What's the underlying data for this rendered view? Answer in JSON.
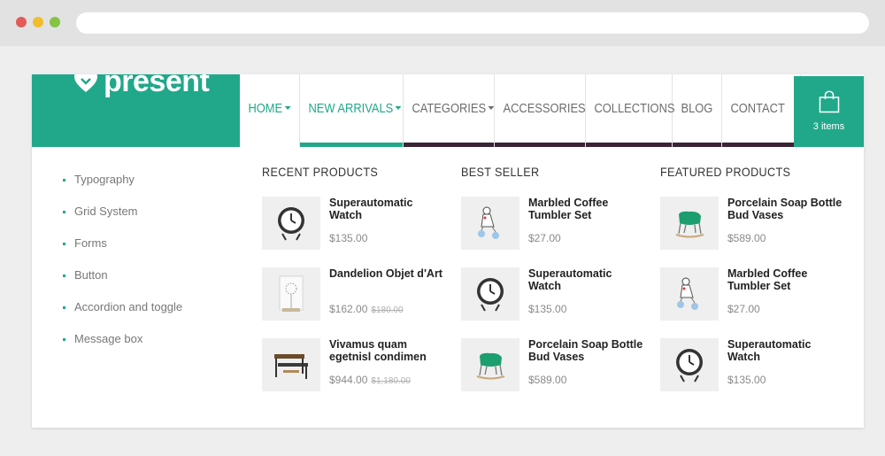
{
  "brand": {
    "name": "present",
    "color": "#21a88a",
    "accent_dark": "#3a2435"
  },
  "nav": [
    {
      "label": "HOME",
      "active": true,
      "has_caret": true
    },
    {
      "label": "NEW ARRIVALS",
      "active": true,
      "has_caret": true
    },
    {
      "label": "CATEGORIES",
      "active": false,
      "has_caret": true
    },
    {
      "label": "ACCESSORIES",
      "active": false,
      "has_caret": false
    },
    {
      "label": "COLLECTIONS",
      "active": false,
      "has_caret": false
    },
    {
      "label": "BLOG",
      "active": false,
      "has_caret": false
    },
    {
      "label": "CONTACT",
      "active": false,
      "has_caret": false
    }
  ],
  "cart": {
    "label": "3 items",
    "icon": "shopping-bag-icon"
  },
  "sidebar": {
    "items": [
      {
        "label": "Typography"
      },
      {
        "label": "Grid System"
      },
      {
        "label": "Forms"
      },
      {
        "label": "Button"
      },
      {
        "label": "Accordion and toggle"
      },
      {
        "label": "Message box"
      }
    ]
  },
  "columns": [
    {
      "title": "RECENT PRODUCTS",
      "products": [
        {
          "name": "Superautomatic Watch",
          "price": "$135.00",
          "old_price": "",
          "image": "clock"
        },
        {
          "name": "Dandelion Objet d'Art",
          "price": "$162.00",
          "old_price": "$180.00",
          "image": "dandelion"
        },
        {
          "name": "Vivamus quam egetnisl condimen",
          "price": "$944.00",
          "old_price": "$1,180.00",
          "image": "table"
        }
      ]
    },
    {
      "title": "BEST SELLER",
      "products": [
        {
          "name": "Marbled Coffee Tumbler Set",
          "price": "$27.00",
          "old_price": "",
          "image": "toy"
        },
        {
          "name": "Superautomatic Watch",
          "price": "$135.00",
          "old_price": "",
          "image": "clock"
        },
        {
          "name": "Porcelain Soap Bottle Bud Vases",
          "price": "$589.00",
          "old_price": "",
          "image": "chair"
        }
      ]
    },
    {
      "title": "FEATURED PRODUCTS",
      "products": [
        {
          "name": "Porcelain Soap Bottle Bud Vases",
          "price": "$589.00",
          "old_price": "",
          "image": "chair"
        },
        {
          "name": "Marbled Coffee Tumbler Set",
          "price": "$27.00",
          "old_price": "",
          "image": "toy"
        },
        {
          "name": "Superautomatic Watch",
          "price": "$135.00",
          "old_price": "",
          "image": "clock"
        }
      ]
    }
  ]
}
